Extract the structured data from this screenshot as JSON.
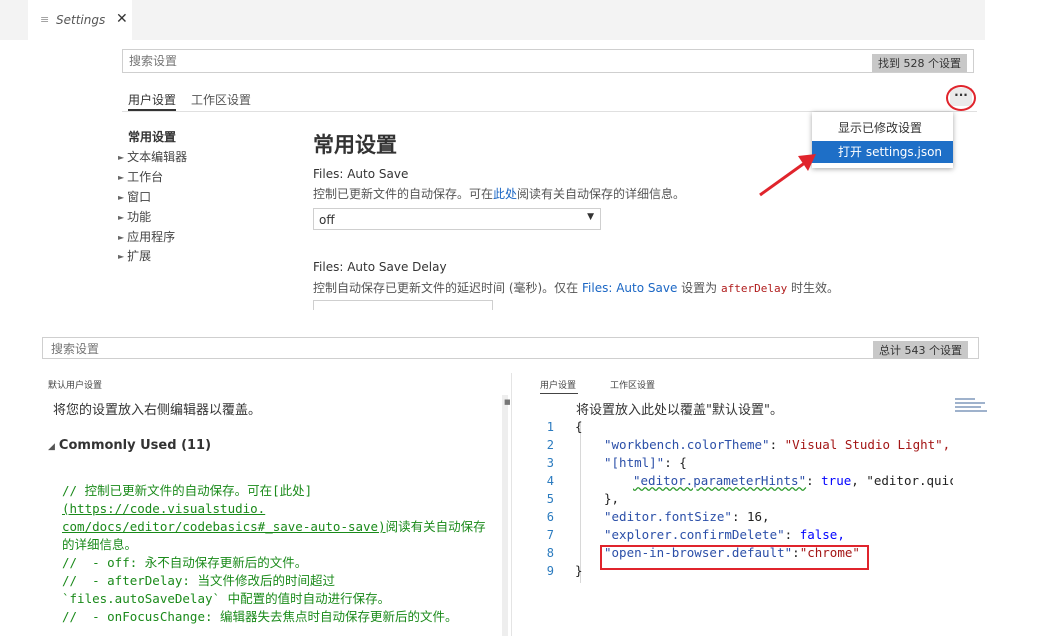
{
  "tab": {
    "icon": "list-icon",
    "title": "Settings",
    "close": "✕"
  },
  "top_search": {
    "placeholder": "搜索设置",
    "count": "找到 528 个设置"
  },
  "scope_tabs": [
    {
      "label": "用户设置"
    },
    {
      "label": "工作区设置"
    }
  ],
  "more_button": {
    "label": "···"
  },
  "menu": {
    "items": [
      {
        "label": "显示已修改设置"
      },
      {
        "label": "打开 settings.json"
      }
    ]
  },
  "toc": {
    "head": "常用设置",
    "items": [
      {
        "label": "文本编辑器"
      },
      {
        "label": "工作台"
      },
      {
        "label": "窗口"
      },
      {
        "label": "功能"
      },
      {
        "label": "应用程序"
      },
      {
        "label": "扩展"
      }
    ]
  },
  "main": {
    "heading": "常用设置",
    "auto_save": {
      "title": "Files: Auto Save",
      "desc_pre": "控制已更新文件的自动保存。可在",
      "desc_link": "此处",
      "desc_post": "阅读有关自动保存的详细信息。",
      "value": "off"
    },
    "auto_save_delay": {
      "title": "Files: Auto Save Delay",
      "desc_pre": "控制自动保存已更新文件的延迟时间 (毫秒)。仅在 ",
      "desc_link": "Files: Auto Save",
      "desc_mid": " 设置为 ",
      "desc_code": "afterDelay",
      "desc_post": " 时生效。"
    }
  },
  "bottom_search": {
    "placeholder": "搜索设置",
    "count": "总计 543 个设置"
  },
  "left_panel": {
    "header": "默认用户设置",
    "hint": "将您的设置放入右侧编辑器以覆盖。",
    "group": "Commonly Used (11)",
    "comment_lines": [
      "// 控制已更新文件的自动保存。可在[此处]",
      "(https://code.visualstudio.",
      "com/docs/editor/codebasics#_save-auto-save)阅读有关自动保存",
      "的详细信息。",
      "//  - off: 永不自动保存更新后的文件。",
      "//  - afterDelay: 当文件修改后的时间超过",
      "`files.autoSaveDelay` 中配置的值时自动进行保存。",
      "//  - onFocusChange: 编辑器失去焦点时自动保存更新后的文件。"
    ]
  },
  "right_panel": {
    "tabs": [
      {
        "label": "用户设置"
      },
      {
        "label": "工作区设置"
      }
    ],
    "hint": "将设置放入此处以覆盖\"默认设置\"。",
    "line_numbers": [
      "1",
      "2",
      "3",
      "4",
      "5",
      "6",
      "7",
      "8",
      "9"
    ],
    "code": {
      "l1": "{",
      "l2_key": "\"workbench.colorTheme\"",
      "l2_val": "\"Visual Studio Light\",",
      "l3_key": "\"[html]\"",
      "l3_rest": ": {",
      "l4_key": "\"editor.parameterHints\"",
      "l4_val": "true",
      "l4_rest": ", \"editor.quic",
      "l5": "},",
      "l6_key": "\"editor.fontSize\"",
      "l6_val": "16,",
      "l7_key": "\"explorer.confirmDelete\"",
      "l7_val": "false,",
      "l8_key": "\"open-in-browser.default\"",
      "l8_val": "\"chrome\"",
      "l9": "}"
    }
  },
  "colors": {
    "accent": "#1e6fc7",
    "highlight": "#e0242c",
    "comment": "#1a8a1a",
    "link": "#1a66c4"
  }
}
